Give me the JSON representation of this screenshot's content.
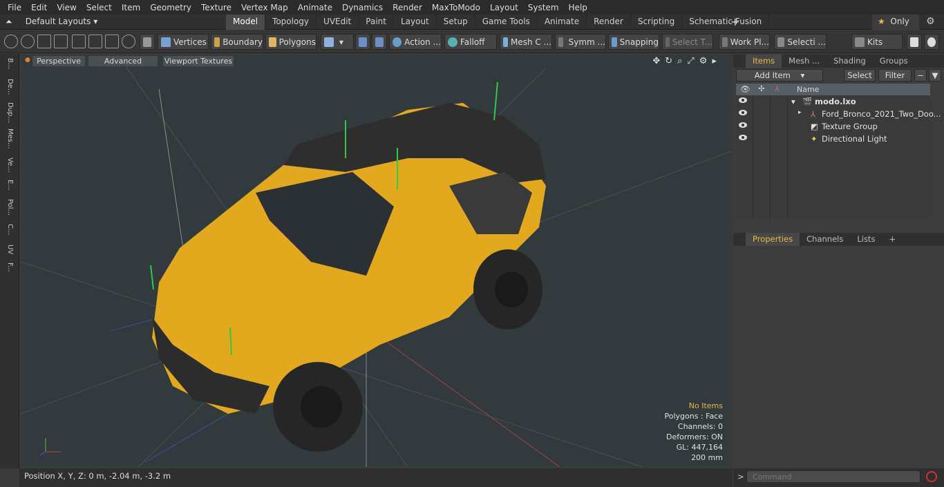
{
  "menu": [
    "File",
    "Edit",
    "View",
    "Select",
    "Item",
    "Geometry",
    "Texture",
    "Vertex Map",
    "Animate",
    "Dynamics",
    "Render",
    "MaxToModo",
    "Layout",
    "System",
    "Help"
  ],
  "layouts": "Default Layouts",
  "tabs": [
    "Model",
    "Topology",
    "UVEdit",
    "Paint",
    "Layout",
    "Setup",
    "Game Tools",
    "Animate",
    "Render",
    "Scripting",
    "Schematic Fusion"
  ],
  "only": "Only",
  "toolbar": {
    "vertices": "Vertices",
    "boundary": "Boundary",
    "polygons": "Polygons",
    "action": "Action",
    "falloff": "Falloff",
    "mesh": "Mesh C ...",
    "symm": "Symm ...",
    "snapping": "Snapping",
    "select_t": "Select T...",
    "work": "Work Pl...",
    "selecti": "Selecti ...",
    "kits": "Kits"
  },
  "left_tabs": [
    "B...",
    "De...",
    "Dup...",
    "Mes...",
    "Ve...",
    "E...",
    "Pol...",
    "C...",
    "UV",
    "F..."
  ],
  "viewport": {
    "perspective": "Perspective",
    "advanced": "Advanced",
    "textures": "Viewport Textures",
    "info": {
      "no_items": "No Items",
      "polygons": "Polygons : Face",
      "channels": "Channels: 0",
      "deformers": "Deformers: ON",
      "gl": "GL: 447,164",
      "scale": "200 mm"
    }
  },
  "status": "Position X, Y, Z:   0 m, -2.04 m, -3.2 m",
  "right": {
    "tabs": [
      "Items",
      "Mesh ...",
      "Shading",
      "Groups"
    ],
    "add_item": "Add Item",
    "select": "Select",
    "filter": "Filter",
    "name_col": "Name",
    "tree": [
      "modo.lxo",
      "Ford_Bronco_2021_Two_Doo...",
      "Texture Group",
      "Directional Light"
    ],
    "ptabs": [
      "Properties",
      "Channels",
      "Lists"
    ]
  },
  "command_placeholder": "Command"
}
